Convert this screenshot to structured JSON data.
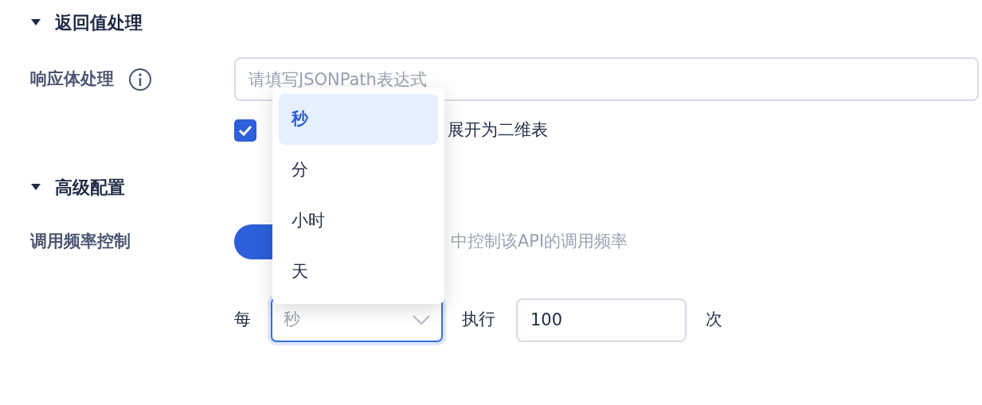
{
  "sections": [
    {
      "title": "返回值处理",
      "expanded": true
    },
    {
      "title": "高级配置",
      "expanded": true
    }
  ],
  "response_body": {
    "label": "响应体处理",
    "input": {
      "placeholder": "请填写JSONPath表达式"
    },
    "checkbox": {
      "checked": true,
      "label": "展开为二维表"
    }
  },
  "rate_limit": {
    "label": "调用频率控制",
    "switch": {
      "on": true
    },
    "description": "中控制该API的调用频率"
  },
  "frequency": {
    "prefix": "每",
    "unit_select": {
      "value": "秒",
      "open": true
    },
    "middle": "执行",
    "count": {
      "value": "100"
    },
    "suffix": "次"
  },
  "dropdown_options": [
    {
      "label": "秒",
      "selected": true
    },
    {
      "label": "分",
      "selected": false
    },
    {
      "label": "小时",
      "selected": false
    },
    {
      "label": "天",
      "selected": false
    }
  ]
}
